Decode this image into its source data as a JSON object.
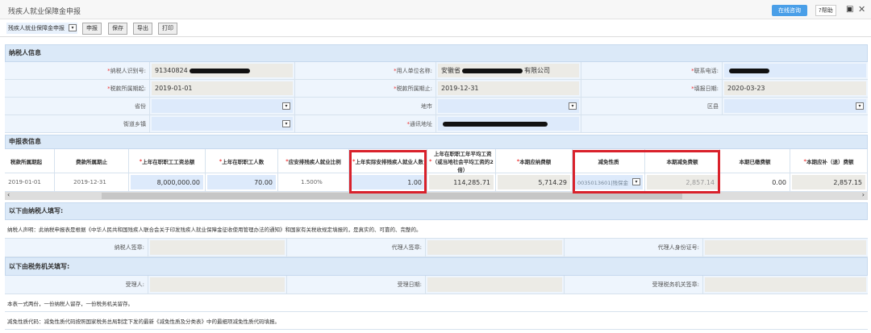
{
  "window": {
    "title": "残疾人就业保障金申报",
    "online_service": "在线咨询",
    "help": "?帮助",
    "restore_icon": "▣",
    "close_icon": "✕"
  },
  "toolbar": {
    "form_select": "残疾人就业保障金申报",
    "buttons": [
      "申报",
      "保存",
      "导出",
      "打印"
    ]
  },
  "taxpayer_info": {
    "section_title": "纳税人信息",
    "tax_id_label": "纳税人识别号:",
    "tax_id": "91340824",
    "employer_label": "用人单位名称:",
    "employer_prefix": "安徽省",
    "employer_suffix": "有限公司",
    "phone_label": "联系电话:",
    "period_start_label": "税款所属期起:",
    "period_start": "2019-01-01",
    "period_end_label": "税款所属期止:",
    "period_end": "2019-12-31",
    "report_date_label": "填报日期:",
    "report_date": "2020-03-23",
    "province_label": "省份",
    "city_label": "地市",
    "district_label": "区县",
    "street_label": "街道乡镇",
    "address_label": "通讯地址"
  },
  "report_info": {
    "section_title": "申报表信息",
    "headers": [
      "税款所属期起",
      "费款所属期止",
      "上年在职职工工资总额",
      "上年在职职工人数",
      "应安排残疾人就业比例",
      "上年实际安排残疾人就业人数",
      "上年在职职工年平均工资（或当地社会平均工资的2倍）",
      "本期应纳费额",
      "减免性质",
      "本期减免费额",
      "本期已缴费额",
      "本期应补（退）费额"
    ],
    "required": [
      false,
      false,
      true,
      true,
      true,
      true,
      true,
      true,
      false,
      false,
      false,
      true
    ],
    "row": [
      "2019-01-01",
      "2019-12-31",
      "8,000,000.00",
      "70.00",
      "1.500%",
      "1.00",
      "114,285.71",
      "5,714.29",
      "0035013601|残保金",
      "2,857.14",
      "0.00",
      "2,857.15"
    ]
  },
  "taxpayer_fill": {
    "section_title": "以下由纳税人填写:",
    "declaration": "纳税人声明：此纳税申报表是根据《中华人民共和国残疾人联合会关于印发残疾人就业保障金征收使用管理办法的通知》和国家有关税收规定填报的，是真实的、可靠的、完整的。",
    "signature_label": "纳税人签章:",
    "agent_signature_label": "代理人签章:",
    "agent_id_label": "代理人身份证号:"
  },
  "tax_office_fill": {
    "section_title": "以下由税务机关填写:",
    "receiver_label": "受理人:",
    "receive_date_label": "受理日期:",
    "office_seal_label": "受理税务机关签章:",
    "note1": "本表一式两份，一份纳税人留存，一份税务机关留存。",
    "note2": "减免性质代码：减免性质代码按照国家税务总局制定下发的最新《减免性质及分类表》中的最细项减免性质代码填报。"
  },
  "colors": {
    "highlight": "#d9212b",
    "online": "#4a9fe8",
    "section": "#dbe9f8"
  }
}
